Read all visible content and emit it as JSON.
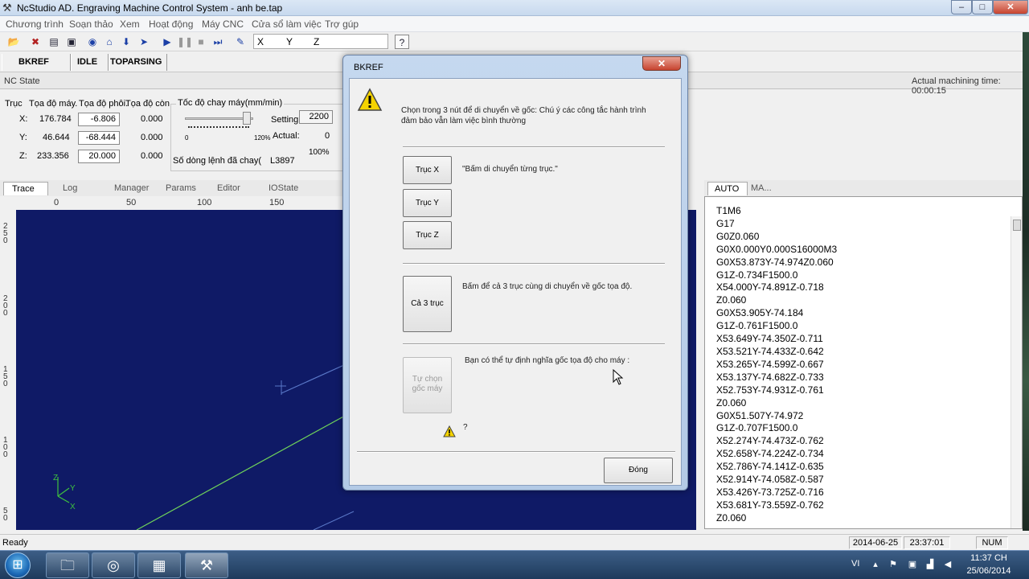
{
  "window": {
    "title": "NcStudio AD. Engraving Machine Control System  - anh be.tap",
    "min": "–",
    "max": "□",
    "close": "✕"
  },
  "menu": [
    "Chương trình",
    "Soạn thảo",
    "Xem",
    "Hoạt động",
    "Máy CNC",
    "Cửa sổ làm việc",
    "Trợ gúp"
  ],
  "toolbar": {
    "axes": [
      "X",
      "Y",
      "Z"
    ]
  },
  "state": {
    "mode": "BKREF",
    "status": "IDLE",
    "phase": "TOPARSING"
  },
  "ncstate": {
    "label": "NC State",
    "machining_time": "Actual machining time: 00:00:15"
  },
  "coords": {
    "hdr_axis": "Trục",
    "hdr_machine": "Tọa độ máy.",
    "hdr_work": "Tọa độ phôi.",
    "hdr_remain": "Tọa độ còn",
    "rows": [
      {
        "axis": "X:",
        "machine": "176.784",
        "work": "-6.806",
        "remain": "0.000"
      },
      {
        "axis": "Y:",
        "machine": "46.644",
        "work": "-68.444",
        "remain": "0.000"
      },
      {
        "axis": "Z:",
        "machine": "233.356",
        "work": "20.000",
        "remain": "0.000"
      }
    ],
    "speed_title": "Tốc độ chay máy(mm/min)",
    "setting_label": "Setting:",
    "setting_value": "2200",
    "actual_label": "Actual:",
    "actual_value": "0",
    "slider_min": "0",
    "slider_max": "120%",
    "percent": "100%",
    "lines_label": "Số dòng lệnh đã chay(",
    "lines_value": "L3897",
    "speed_fraction": 0.85
  },
  "tabs": [
    "Trace",
    "Log",
    "Manager",
    "Params",
    "Editor",
    "IOState"
  ],
  "ruler": {
    "top": [
      "0",
      "50",
      "100",
      "150"
    ],
    "left": [
      "2\n5\n0",
      "2\n0\n0",
      "1\n5\n0",
      "1\n0\n0",
      "5\n0"
    ]
  },
  "viewport": {
    "axis_x": "X",
    "axis_y": "Y",
    "axis_z": "Z",
    "marker": "+"
  },
  "gcode": {
    "tabs": [
      "AUTO",
      "MA..."
    ],
    "lines": [
      "T1M6",
      "G17",
      "G0Z0.060",
      "G0X0.000Y0.000S16000M3",
      "G0X53.873Y-74.974Z0.060",
      "G1Z-0.734F1500.0",
      "X54.000Y-74.891Z-0.718",
      "Z0.060",
      "G0X53.905Y-74.184",
      "G1Z-0.761F1500.0",
      "X53.649Y-74.350Z-0.711",
      "X53.521Y-74.433Z-0.642",
      "X53.265Y-74.599Z-0.667",
      "X53.137Y-74.682Z-0.733",
      "X52.753Y-74.931Z-0.761",
      "Z0.060",
      "G0X51.507Y-74.972",
      "G1Z-0.707F1500.0",
      "X52.274Y-74.473Z-0.762",
      "X52.658Y-74.224Z-0.734",
      "X52.786Y-74.141Z-0.635",
      "X52.914Y-74.058Z-0.587",
      "X53.426Y-73.725Z-0.716",
      "X53.681Y-73.559Z-0.762",
      "Z0.060"
    ]
  },
  "statusbar": {
    "ready": "Ready",
    "date": "2014-06-25",
    "time": "23:37:01",
    "num": "NUM"
  },
  "taskbar": {
    "lang": "VI",
    "clock_time": "11:37 CH",
    "clock_date": "25/06/2014"
  },
  "dialog": {
    "title": "BKREF",
    "close": "✕",
    "intro_line1": "Chọn trong 3 nút để di chuyển về gốc:   Chú ý các công tắc hành trình",
    "intro_line2": "đảm bảo vẫn làm việc bình thường",
    "btn_x": "Trục X",
    "btn_y": "Trục Y",
    "btn_z": "Trục Z",
    "single_hint": "\"Bấm di chuyển từng trục.\"",
    "btn_all": "Cả 3 trục",
    "all_hint": "Bấm để cả 3 trục cùng di chuyển về gốc tọa độ.",
    "custom_hint": "Bạn có thể tự định nghĩa gốc tọa độ cho máy :",
    "btn_custom_1": "Tự chọn",
    "btn_custom_2": "gốc máy",
    "question": "?",
    "btn_close": "Đóng"
  },
  "colors": {
    "viewport_bg": "#0f1a66",
    "toolpath": "#6fd35a",
    "grid_line": "#5a78c8",
    "axis_green": "#3ec23e"
  }
}
